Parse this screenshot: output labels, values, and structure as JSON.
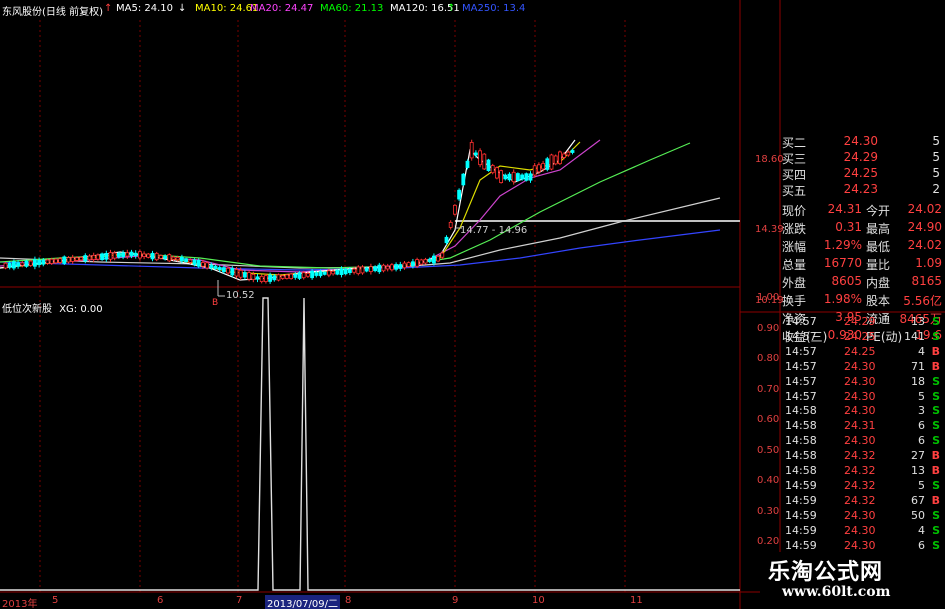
{
  "header": {
    "stock": "东风股份(日线 前复权)",
    "ma5": "MA5: 24.10",
    "ma10": "MA10: 24.61",
    "ma20": "MA20: 24.47",
    "ma60": "MA60: 21.13",
    "ma120": "MA120: 16.51",
    "ma250": "MA250: 13.4",
    "colors": {
      "ma5": "#ffffff",
      "ma10": "#ffff00",
      "ma20": "#ff00ff",
      "ma60": "#00ff00",
      "ma120": "#ffffff",
      "ma250": "#3355ff"
    }
  },
  "main_chart": {
    "price_axis": [
      "18.60",
      "14.39",
      "10.19"
    ],
    "annotations": {
      "low": "10.52",
      "range": "14.77 - 14.96",
      "marker": "B"
    }
  },
  "indicator": {
    "title": "低位次新股",
    "value": "XG: 0.00",
    "axis": [
      "1.00",
      "0.90",
      "0.80",
      "0.70",
      "0.60",
      "0.50",
      "0.40",
      "0.30",
      "0.20"
    ]
  },
  "quote": {
    "bids": [
      {
        "label": "买二",
        "price": "24.30",
        "vol": "5"
      },
      {
        "label": "买三",
        "price": "24.29",
        "vol": "5"
      },
      {
        "label": "买四",
        "price": "24.25",
        "vol": "5"
      },
      {
        "label": "买五",
        "price": "24.23",
        "vol": "2"
      }
    ],
    "stats": [
      {
        "k1": "现价",
        "v1": "24.31",
        "k2": "今开",
        "v2": "24.02"
      },
      {
        "k1": "涨跌",
        "v1": "0.31",
        "k2": "最高",
        "v2": "24.90"
      },
      {
        "k1": "涨幅",
        "v1": "1.29%",
        "k2": "最低",
        "v2": "24.02"
      },
      {
        "k1": "总量",
        "v1": "16770",
        "k2": "量比",
        "v2": "1.09"
      },
      {
        "k1": "外盘",
        "v1": "8605",
        "k2": "内盘",
        "v2": "8165"
      },
      {
        "k1": "换手",
        "v1": "1.98%",
        "k2": "股本",
        "v2": "5.56亿"
      },
      {
        "k1": "净资",
        "v1": "3.95",
        "k2": "流通",
        "v2": "8465万"
      },
      {
        "k1": "收益(三)",
        "v1": "0.930",
        "k2": "PE(动)",
        "v2": "19.6"
      }
    ]
  },
  "trades": [
    {
      "time": "14:57",
      "price": "24.29",
      "vol": "13",
      "bs": "S"
    },
    {
      "time": "14:57",
      "price": "24.25",
      "vol": "141",
      "bs": "S"
    },
    {
      "time": "14:57",
      "price": "24.25",
      "vol": "4",
      "bs": "B"
    },
    {
      "time": "14:57",
      "price": "24.30",
      "vol": "71",
      "bs": "B"
    },
    {
      "time": "14:57",
      "price": "24.30",
      "vol": "18",
      "bs": "S"
    },
    {
      "time": "14:57",
      "price": "24.30",
      "vol": "5",
      "bs": "S"
    },
    {
      "time": "14:58",
      "price": "24.30",
      "vol": "3",
      "bs": "S"
    },
    {
      "time": "14:58",
      "price": "24.31",
      "vol": "6",
      "bs": "S"
    },
    {
      "time": "14:58",
      "price": "24.30",
      "vol": "6",
      "bs": "S"
    },
    {
      "time": "14:58",
      "price": "24.32",
      "vol": "27",
      "bs": "B"
    },
    {
      "time": "14:58",
      "price": "24.32",
      "vol": "13",
      "bs": "B"
    },
    {
      "time": "14:59",
      "price": "24.32",
      "vol": "5",
      "bs": "S"
    },
    {
      "time": "14:59",
      "price": "24.32",
      "vol": "67",
      "bs": "B"
    },
    {
      "time": "14:59",
      "price": "24.30",
      "vol": "50",
      "bs": "S"
    },
    {
      "time": "14:59",
      "price": "24.30",
      "vol": "4",
      "bs": "S"
    },
    {
      "time": "14:59",
      "price": "24.30",
      "vol": "6",
      "bs": "S"
    }
  ],
  "xaxis": [
    "2013年",
    "5",
    "6",
    "7",
    "2013/07/09/二",
    "8",
    "9",
    "10",
    "11"
  ],
  "watermark": {
    "title": "乐淘公式网",
    "url": "www.60lt.com"
  }
}
